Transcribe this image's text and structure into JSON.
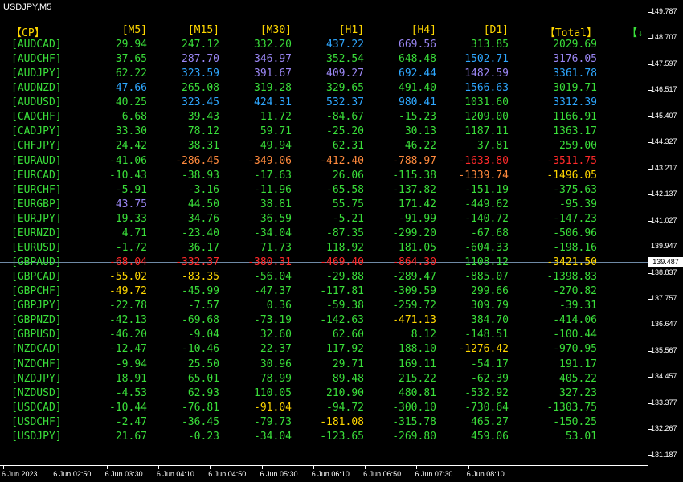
{
  "window": {
    "title": "USDJPY,M5"
  },
  "colors": {
    "header": "#ffd700",
    "pair": "#3adf3a",
    "price_line": "#6f8aa6"
  },
  "table": {
    "headers": [
      "[M5]",
      "[M15]",
      "[M30]",
      "[H1]",
      "[H4]",
      "[D1]",
      "【Total】"
    ],
    "corner_label": "【CP】",
    "corner_right": "【↓",
    "rows": [
      {
        "pair": "[AUDCAD]",
        "v": [
          "29.94",
          "247.12",
          "332.20",
          "437.22",
          "669.56",
          "313.85",
          "2029.69"
        ],
        "c": [
          "g",
          "g",
          "g",
          "b",
          "v",
          "g",
          "g"
        ]
      },
      {
        "pair": "[AUDCHF]",
        "v": [
          "37.65",
          "287.70",
          "346.97",
          "352.54",
          "648.48",
          "1502.71",
          "3176.05"
        ],
        "c": [
          "g",
          "v",
          "v",
          "g",
          "g",
          "b",
          "v"
        ]
      },
      {
        "pair": "[AUDJPY]",
        "v": [
          "62.22",
          "323.59",
          "391.67",
          "409.27",
          "692.44",
          "1482.59",
          "3361.78"
        ],
        "c": [
          "g",
          "b",
          "v",
          "v",
          "b",
          "v",
          "b"
        ]
      },
      {
        "pair": "[AUDNZD]",
        "v": [
          "47.66",
          "265.08",
          "319.28",
          "329.65",
          "491.40",
          "1566.63",
          "3019.71"
        ],
        "c": [
          "b",
          "g",
          "g",
          "g",
          "g",
          "b",
          "g"
        ]
      },
      {
        "pair": "[AUDUSD]",
        "v": [
          "40.25",
          "323.45",
          "424.31",
          "532.37",
          "980.41",
          "1031.60",
          "3312.39"
        ],
        "c": [
          "g",
          "b",
          "b",
          "b",
          "b",
          "g",
          "b"
        ]
      },
      {
        "pair": "[CADCHF]",
        "v": [
          "6.68",
          "39.43",
          "11.72",
          "-84.67",
          "-15.23",
          "1209.00",
          "1166.91"
        ],
        "c": [
          "g",
          "g",
          "g",
          "g",
          "g",
          "g",
          "g"
        ]
      },
      {
        "pair": "[CADJPY]",
        "v": [
          "33.30",
          "78.12",
          "59.71",
          "-25.20",
          "30.13",
          "1187.11",
          "1363.17"
        ],
        "c": [
          "g",
          "g",
          "g",
          "g",
          "g",
          "g",
          "g"
        ]
      },
      {
        "pair": "[CHFJPY]",
        "v": [
          "24.42",
          "38.31",
          "49.94",
          "62.31",
          "46.22",
          "37.81",
          "259.00"
        ],
        "c": [
          "g",
          "g",
          "g",
          "g",
          "g",
          "g",
          "g"
        ]
      },
      {
        "pair": "[EURAUD]",
        "v": [
          "-41.06",
          "-286.45",
          "-349.06",
          "-412.40",
          "-788.97",
          "-1633.80",
          "-3511.75"
        ],
        "c": [
          "g",
          "o",
          "o",
          "o",
          "o",
          "r",
          "r"
        ]
      },
      {
        "pair": "[EURCAD]",
        "v": [
          "-10.43",
          "-38.93",
          "-17.63",
          "26.06",
          "-115.38",
          "-1339.74",
          "-1496.05"
        ],
        "c": [
          "g",
          "g",
          "g",
          "g",
          "g",
          "o",
          "y"
        ]
      },
      {
        "pair": "[EURCHF]",
        "v": [
          "-5.91",
          "-3.16",
          "-11.96",
          "-65.58",
          "-137.82",
          "-151.19",
          "-375.63"
        ],
        "c": [
          "g",
          "g",
          "g",
          "g",
          "g",
          "g",
          "g"
        ]
      },
      {
        "pair": "[EURGBP]",
        "v": [
          "43.75",
          "44.50",
          "38.81",
          "55.75",
          "171.42",
          "-449.62",
          "-95.39"
        ],
        "c": [
          "v",
          "g",
          "g",
          "g",
          "g",
          "g",
          "g"
        ]
      },
      {
        "pair": "[EURJPY]",
        "v": [
          "19.33",
          "34.76",
          "36.59",
          "-5.21",
          "-91.99",
          "-140.72",
          "-147.23"
        ],
        "c": [
          "g",
          "g",
          "g",
          "g",
          "g",
          "g",
          "g"
        ]
      },
      {
        "pair": "[EURNZD]",
        "v": [
          "4.71",
          "-23.40",
          "-34.04",
          "-87.35",
          "-299.20",
          "-67.68",
          "-506.96"
        ],
        "c": [
          "g",
          "g",
          "g",
          "g",
          "g",
          "g",
          "g"
        ]
      },
      {
        "pair": "[EURUSD]",
        "v": [
          "-1.72",
          "36.17",
          "71.73",
          "118.92",
          "181.05",
          "-604.33",
          "-198.16"
        ],
        "c": [
          "g",
          "g",
          "g",
          "g",
          "g",
          "g",
          "g"
        ]
      },
      {
        "pair": "[GBPAUD]",
        "v": [
          "-68.04",
          "-332.37",
          "-380.31",
          "-469.40",
          "-864.30",
          "1108.12",
          "-3421.50"
        ],
        "c": [
          "r",
          "r",
          "r",
          "r",
          "r",
          "g",
          "y"
        ]
      },
      {
        "pair": "[GBPCAD]",
        "v": [
          "-55.02",
          "-83.35",
          "-56.04",
          "-29.88",
          "-289.47",
          "-885.07",
          "-1398.83"
        ],
        "c": [
          "y",
          "y",
          "g",
          "g",
          "g",
          "g",
          "g"
        ]
      },
      {
        "pair": "[GBPCHF]",
        "v": [
          "-49.72",
          "-45.99",
          "-47.37",
          "-117.81",
          "-309.59",
          "299.66",
          "-270.82"
        ],
        "c": [
          "y",
          "g",
          "g",
          "g",
          "g",
          "g",
          "g"
        ]
      },
      {
        "pair": "[GBPJPY]",
        "v": [
          "-22.78",
          "-7.57",
          "0.36",
          "-59.38",
          "-259.72",
          "309.79",
          "-39.31"
        ],
        "c": [
          "g",
          "g",
          "g",
          "g",
          "g",
          "g",
          "g"
        ]
      },
      {
        "pair": "[GBPNZD]",
        "v": [
          "-42.13",
          "-69.68",
          "-73.19",
          "-142.63",
          "-471.13",
          "384.70",
          "-414.06"
        ],
        "c": [
          "g",
          "g",
          "g",
          "g",
          "y",
          "g",
          "g"
        ]
      },
      {
        "pair": "[GBPUSD]",
        "v": [
          "-46.20",
          "-9.04",
          "32.60",
          "62.60",
          "8.12",
          "-148.51",
          "-100.44"
        ],
        "c": [
          "g",
          "g",
          "g",
          "g",
          "g",
          "g",
          "g"
        ]
      },
      {
        "pair": "[NZDCAD]",
        "v": [
          "-12.47",
          "-10.46",
          "22.37",
          "117.92",
          "188.10",
          "-1276.42",
          "-970.95"
        ],
        "c": [
          "g",
          "g",
          "g",
          "g",
          "g",
          "y",
          "g"
        ]
      },
      {
        "pair": "[NZDCHF]",
        "v": [
          "-9.94",
          "25.50",
          "30.96",
          "29.71",
          "169.11",
          "-54.17",
          "191.17"
        ],
        "c": [
          "g",
          "g",
          "g",
          "g",
          "g",
          "g",
          "g"
        ]
      },
      {
        "pair": "[NZDJPY]",
        "v": [
          "18.91",
          "65.01",
          "78.99",
          "89.48",
          "215.22",
          "-62.39",
          "405.22"
        ],
        "c": [
          "g",
          "g",
          "g",
          "g",
          "g",
          "g",
          "g"
        ]
      },
      {
        "pair": "[NZDUSD]",
        "v": [
          "-4.53",
          "62.93",
          "110.05",
          "210.90",
          "480.81",
          "-532.92",
          "327.23"
        ],
        "c": [
          "g",
          "g",
          "g",
          "g",
          "g",
          "g",
          "g"
        ]
      },
      {
        "pair": "[USDCAD]",
        "v": [
          "-10.44",
          "-76.81",
          "-91.04",
          "-94.72",
          "-300.10",
          "-730.64",
          "-1303.75"
        ],
        "c": [
          "g",
          "g",
          "y",
          "g",
          "g",
          "g",
          "g"
        ]
      },
      {
        "pair": "[USDCHF]",
        "v": [
          "-2.47",
          "-36.45",
          "-79.73",
          "-181.08",
          "-315.78",
          "465.27",
          "-150.25"
        ],
        "c": [
          "g",
          "g",
          "g",
          "y",
          "g",
          "g",
          "g"
        ]
      },
      {
        "pair": "[USDJPY]",
        "v": [
          "21.67",
          "-0.23",
          "-34.04",
          "-123.65",
          "-269.80",
          "459.06",
          "53.01"
        ],
        "c": [
          "g",
          "g",
          "g",
          "g",
          "g",
          "g",
          "g"
        ]
      }
    ]
  },
  "value_colors": {
    "g": "#3adf3a",
    "b": "#2ea7ff",
    "v": "#9b87f5",
    "o": "#ff8a3d",
    "r": "#ff2a2a",
    "y": "#ffd700"
  },
  "price_axis": {
    "labels": [
      "149.787",
      "148.707",
      "147.597",
      "146.517",
      "145.407",
      "144.327",
      "143.217",
      "142.137",
      "141.027",
      "139.947",
      "138.837",
      "137.757",
      "136.647",
      "135.567",
      "134.457",
      "133.377",
      "132.267",
      "131.187"
    ],
    "current_price": "139.487"
  },
  "time_axis": {
    "labels": [
      "6 Jun 2023",
      "6 Jun 02:50",
      "6 Jun 03:30",
      "6 Jun 04:10",
      "6 Jun 04:50",
      "6 Jun 05:30",
      "6 Jun 06:10",
      "6 Jun 06:50",
      "6 Jun 07:30",
      "6 Jun 08:10"
    ]
  }
}
